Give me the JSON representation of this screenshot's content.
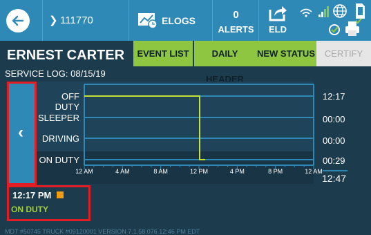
{
  "topbar": {
    "vehicle_id": "111770",
    "elogs_label": "ELOGS",
    "alerts_count": "0",
    "alerts_label": "ALERTS",
    "eld_label": "ELD"
  },
  "driver": {
    "name": "ERNEST CARTER"
  },
  "actions": {
    "event_list": "EVENT LIST",
    "daily_header": "DAILY HEADER",
    "new_status": "NEW STATUS",
    "certify": "CERTIFY"
  },
  "service_log": "SERVICE LOG: 08/15/19",
  "graph": {
    "statuses": [
      "OFF DUTY",
      "SLEEPER",
      "DRIVING",
      "ON DUTY"
    ],
    "totals": [
      "12:17",
      "00:00",
      "00:00",
      "00:29"
    ],
    "grand_total": "12:47",
    "tick_labels": [
      "12 AM",
      "4 AM",
      "8 AM",
      "12 PM",
      "4 PM",
      "8 PM",
      "12 AM"
    ],
    "line_color": "#c8e03c"
  },
  "last_event": {
    "time": "12:17 PM",
    "status": "ON DUTY"
  },
  "footer": {
    "text": "MDT #50745    TRUCK #09120001    VERSION  7.1.58.076    12:46 PM EDT"
  },
  "colors": {
    "accent": "#2e89b7",
    "green_button": "#8ec641",
    "highlight": "#e21d24"
  }
}
